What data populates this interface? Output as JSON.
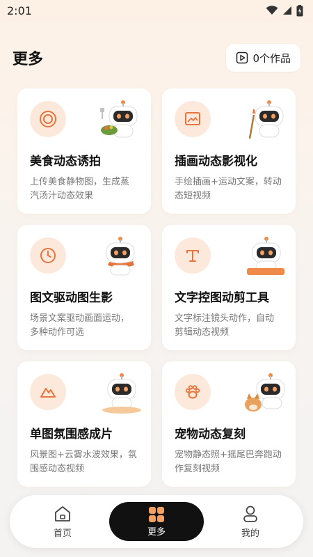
{
  "status_bar": {
    "time": "2:01"
  },
  "header": {
    "title": "更多",
    "works_label": "0个作品"
  },
  "cards": [
    {
      "title": "美食动态诱拍",
      "desc_line1": "上传美食静物图，生成蒸",
      "desc_line2": "汽汤汁动态效果",
      "icon": "target-icon"
    },
    {
      "title": "插画动态影视化",
      "desc_line1": "手绘插画+运动文案，转动",
      "desc_line2": "态短视频",
      "icon": "image-icon"
    },
    {
      "title": "图文驱动图生影",
      "desc_line1": "场景文案驱动画面运动，",
      "desc_line2": "多种动作可选",
      "icon": "clock-icon"
    },
    {
      "title": "文字控图动剪工具",
      "desc_line1": "文字标注镜头动作，自动",
      "desc_line2": "剪辑动态视频",
      "icon": "text-icon"
    },
    {
      "title": "单图氛围感成片",
      "desc_line1": "风景图+云雾水波效果，氛",
      "desc_line2": "围感动态视频",
      "icon": "mountain-icon"
    },
    {
      "title": "宠物动态复刻",
      "desc_line1": "宠物静态照+摇尾巴奔跑动",
      "desc_line2": "作复刻视频",
      "icon": "paw-icon"
    }
  ],
  "tabbar": {
    "home_label": "首页",
    "more_label": "更多",
    "mine_label": "我的"
  },
  "colors": {
    "accent": "#e8743b",
    "icon_bg": "#fde8dc",
    "active_tab_bg": "#111111"
  }
}
